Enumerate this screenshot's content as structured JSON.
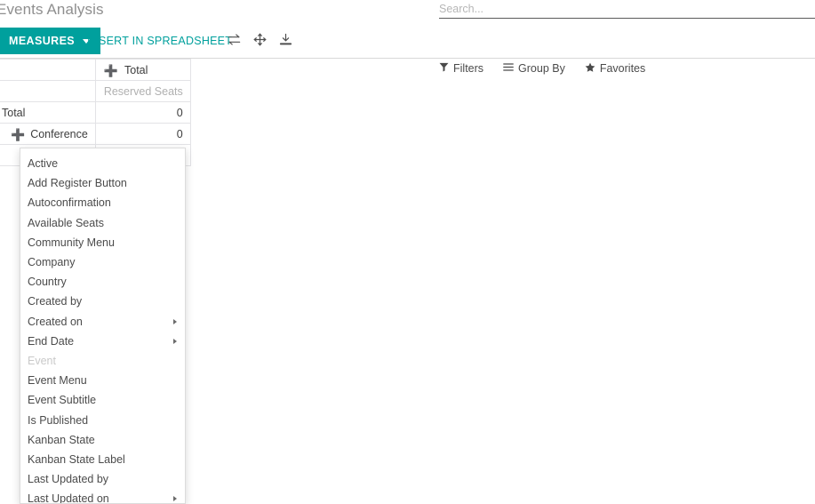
{
  "window": {
    "breadcrumb": "Events Analysis",
    "accent_color": "#00a09d"
  },
  "search": {
    "placeholder": "Search...",
    "value": ""
  },
  "toolbar": {
    "measures_label": "MEASURES",
    "insert_spreadsheet_label": "INSERT IN SPREADSHEET",
    "flip_axis_icon": "exchange-icon",
    "expand_all_icon": "arrows-expand-icon",
    "download_icon": "download-icon"
  },
  "search_panel": {
    "filters_label": "Filters",
    "filters_icon": "filter-icon",
    "group_by_label": "Group By",
    "group_by_icon": "bars-icon",
    "favorites_label": "Favorites",
    "favorites_icon": "star-icon"
  },
  "pivot": {
    "corner_label": "",
    "column_header": "Total",
    "column_header_icon": "plus-icon",
    "measure_header": "Reserved Seats",
    "rows": [
      {
        "label": "Total",
        "icon": "",
        "indent": false,
        "values": [
          "0"
        ]
      },
      {
        "label": "Conference",
        "icon": "plus-icon",
        "indent": true,
        "values": [
          "0"
        ]
      }
    ]
  },
  "dropdown": {
    "items": [
      {
        "label": "Active",
        "submenu": false,
        "disabled": false
      },
      {
        "label": "Add Register Button",
        "submenu": false,
        "disabled": false
      },
      {
        "label": "Autoconfirmation",
        "submenu": false,
        "disabled": false
      },
      {
        "label": "Available Seats",
        "submenu": false,
        "disabled": false
      },
      {
        "label": "Community Menu",
        "submenu": false,
        "disabled": false
      },
      {
        "label": "Company",
        "submenu": false,
        "disabled": false
      },
      {
        "label": "Country",
        "submenu": false,
        "disabled": false
      },
      {
        "label": "Created by",
        "submenu": false,
        "disabled": false
      },
      {
        "label": "Created on",
        "submenu": true,
        "disabled": false
      },
      {
        "label": "End Date",
        "submenu": true,
        "disabled": false
      },
      {
        "label": "Event",
        "submenu": false,
        "disabled": true
      },
      {
        "label": "Event Menu",
        "submenu": false,
        "disabled": false
      },
      {
        "label": "Event Subtitle",
        "submenu": false,
        "disabled": false
      },
      {
        "label": "Is Published",
        "submenu": false,
        "disabled": false
      },
      {
        "label": "Kanban State",
        "submenu": false,
        "disabled": false
      },
      {
        "label": "Kanban State Label",
        "submenu": false,
        "disabled": false
      },
      {
        "label": "Last Updated by",
        "submenu": false,
        "disabled": false
      },
      {
        "label": "Last Updated on",
        "submenu": true,
        "disabled": false
      }
    ]
  }
}
